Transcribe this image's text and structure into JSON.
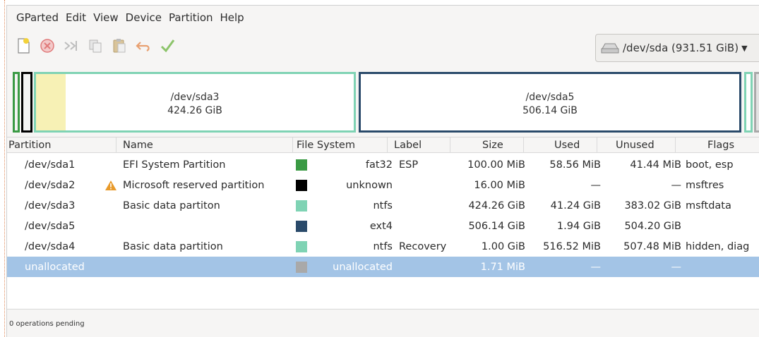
{
  "menu": [
    "GParted",
    "Edit",
    "View",
    "Device",
    "Partition",
    "Help"
  ],
  "toolbar": {
    "icons": [
      "new-icon",
      "delete-icon",
      "resize-move-icon",
      "copy-icon",
      "paste-icon",
      "undo-icon",
      "apply-icon"
    ],
    "device_label": "/dev/sda (931.51 GiB)"
  },
  "diskmap": {
    "sda3": {
      "name": "/dev/sda3",
      "size": "424.26 GiB"
    },
    "sda5": {
      "name": "/dev/sda5",
      "size": "506.14 GiB"
    }
  },
  "table": {
    "columns": [
      "Partition",
      "Name",
      "File System",
      "Label",
      "Size",
      "Used",
      "Unused",
      "Flags"
    ],
    "rows": [
      {
        "partition": "/dev/sda1",
        "warn": false,
        "name": "EFI System Partition",
        "color": "#3a9a44",
        "fs": "fat32",
        "label": "ESP",
        "size": "100.00 MiB",
        "used": "58.56 MiB",
        "unused": "41.44 MiB",
        "flags": "boot, esp"
      },
      {
        "partition": "/dev/sda2",
        "warn": true,
        "name": "Microsoft reserved partition",
        "color": "#000000",
        "fs": "unknown",
        "label": "",
        "size": "16.00 MiB",
        "used": "—",
        "unused": "—",
        "flags": "msftres"
      },
      {
        "partition": "/dev/sda3",
        "warn": false,
        "name": "Basic data partiton",
        "color": "#7fd3b4",
        "fs": "ntfs",
        "label": "",
        "size": "424.26 GiB",
        "used": "41.24 GiB",
        "unused": "383.02 GiB",
        "flags": "msftdata"
      },
      {
        "partition": "/dev/sda5",
        "warn": false,
        "name": "",
        "color": "#2a4a6a",
        "fs": "ext4",
        "label": "",
        "size": "506.14 GiB",
        "used": "1.94 GiB",
        "unused": "504.20 GiB",
        "flags": ""
      },
      {
        "partition": "/dev/sda4",
        "warn": false,
        "name": "Basic data partition",
        "color": "#7fd3b4",
        "fs": "ntfs",
        "label": "Recovery",
        "size": "1.00 GiB",
        "used": "516.52 MiB",
        "unused": "507.48 MiB",
        "flags": "hidden, diag"
      },
      {
        "partition": "unallocated",
        "warn": false,
        "name": "",
        "color": "#a9a9a9",
        "fs": "unallocated",
        "label": "",
        "size": "1.71 MiB",
        "used": "—",
        "unused": "—",
        "flags": ""
      }
    ]
  },
  "status": "0 operations pending"
}
